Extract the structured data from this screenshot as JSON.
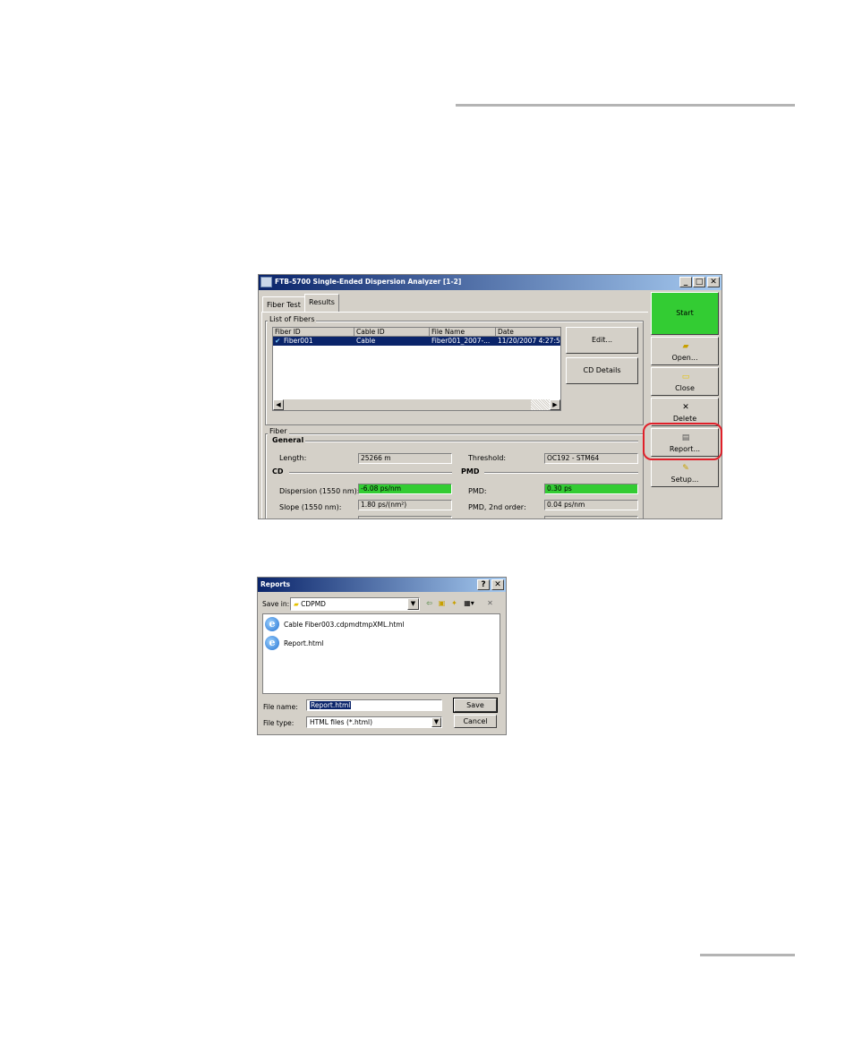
{
  "main_window": {
    "title": "FTB-5700 Single-Ended Dispersion Analyzer [1-2]",
    "tabs": [
      "Fiber Test",
      "Results"
    ],
    "list_of_fibers": {
      "label": "List of Fibers",
      "columns": [
        "Fiber ID",
        "Cable ID",
        "File Name",
        "Date"
      ],
      "rows": [
        {
          "fiber_id": "Fiber001",
          "cable_id": "Cable",
          "file_name": "Fiber001_2007-...",
          "date": "11/20/2007 4:27:5"
        }
      ],
      "edit_button": "Edit...",
      "cd_details_button": "CD Details"
    },
    "side_buttons": {
      "start": "Start",
      "open": "Open...",
      "close": "Close",
      "delete": "Delete",
      "report": "Report...",
      "setup": "Setup..."
    },
    "fiber": {
      "label": "Fiber",
      "general_label": "General",
      "length_label": "Length:",
      "length_value": "25266 m",
      "threshold_label": "Threshold:",
      "threshold_value": "OC192 - STM64",
      "cd_label": "CD",
      "pmd_label": "PMD",
      "dispersion_label": "Dispersion (1550 nm):",
      "dispersion_value": "-6.08 ps/nm",
      "pmd_value_label": "PMD:",
      "pmd_value": "0.30 ps",
      "slope_label": "Slope (1550 nm):",
      "slope_value": "1.80 ps/(nm²)",
      "pmd2_label": "PMD, 2nd order:",
      "pmd2_value": "0.04 ps/nm"
    }
  },
  "reports_dialog": {
    "title": "Reports",
    "help_button": "?",
    "close_button": "✕",
    "save_in_label": "Save in:",
    "save_in_value": "CDPMD",
    "files": [
      "Cable Fiber003.cdpmdtmpXML.html",
      "Report.html"
    ],
    "file_name_label": "File name:",
    "file_name_value": "Report.html",
    "file_type_label": "File type:",
    "file_type_value": "HTML files (*.html)",
    "save_button": "Save",
    "cancel_button": "Cancel"
  }
}
